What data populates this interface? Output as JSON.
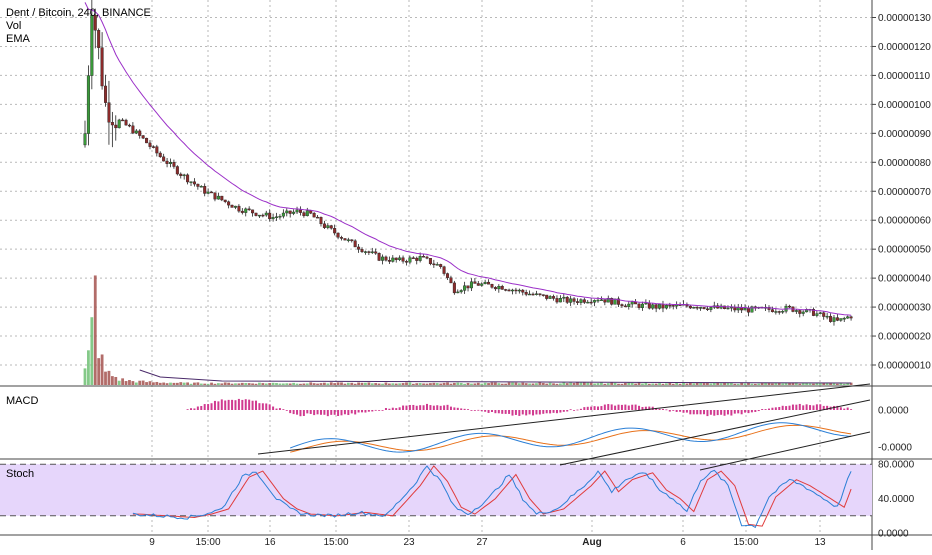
{
  "chart_data": {
    "type": "candlestick",
    "header": {
      "symbol": "Dent / Bitcoin, 240, BINANCE",
      "indicators": [
        "Vol",
        "EMA"
      ]
    },
    "panes": {
      "macd": {
        "label": "MACD",
        "ticks": [
          "0.0000",
          "-0.0000"
        ]
      },
      "stoch": {
        "label": "Stoch",
        "ticks": [
          "80.0000",
          "40.0000",
          "0.0000"
        ],
        "band": [
          20,
          80
        ]
      }
    },
    "price_axis": {
      "ticks": [
        "0.00000130",
        "0.00000120",
        "0.00000110",
        "0.00000100",
        "0.00000090",
        "0.00000080",
        "0.00000070",
        "0.00000060",
        "0.00000050",
        "0.00000040",
        "0.00000030",
        "0.00000020",
        "0.00000010"
      ],
      "values": [
        130,
        120,
        110,
        100,
        90,
        80,
        70,
        60,
        50,
        40,
        30,
        20,
        10
      ],
      "unit_scale": "1e-8"
    },
    "time_axis": {
      "labels": [
        "9",
        "15:00",
        "16",
        "15:00",
        "23",
        "27",
        "Aug",
        "6",
        "15:00",
        "13"
      ],
      "bold": [
        false,
        false,
        false,
        false,
        false,
        false,
        true,
        false,
        false,
        false
      ]
    },
    "price_series": {
      "name": "close",
      "anchors": [
        [
          0,
          90
        ],
        [
          2,
          135
        ],
        [
          4,
          118
        ],
        [
          6,
          100
        ],
        [
          9,
          95
        ],
        [
          13,
          92
        ],
        [
          17,
          88
        ],
        [
          22,
          82
        ],
        [
          28,
          76
        ],
        [
          35,
          70
        ],
        [
          45,
          64
        ],
        [
          55,
          61
        ],
        [
          62,
          63
        ],
        [
          66,
          62
        ],
        [
          70,
          58
        ],
        [
          78,
          52
        ],
        [
          86,
          47
        ],
        [
          92,
          46
        ],
        [
          98,
          47
        ],
        [
          104,
          44
        ],
        [
          108,
          36
        ],
        [
          114,
          38
        ],
        [
          122,
          37
        ],
        [
          132,
          34
        ],
        [
          142,
          32
        ],
        [
          150,
          33
        ],
        [
          158,
          31
        ],
        [
          168,
          30
        ],
        [
          178,
          30.5
        ],
        [
          186,
          29.5
        ],
        [
          196,
          29
        ],
        [
          206,
          29.5
        ],
        [
          213,
          28
        ],
        [
          220,
          25
        ],
        [
          224,
          27
        ]
      ],
      "ema_start": [
        0,
        140
      ]
    },
    "volume_series": {
      "anchors": [
        [
          0,
          15
        ],
        [
          1,
          30
        ],
        [
          2,
          60
        ],
        [
          3,
          100
        ],
        [
          4,
          40
        ],
        [
          5,
          25
        ],
        [
          6,
          14
        ],
        [
          8,
          10
        ],
        [
          10,
          6
        ],
        [
          14,
          4
        ],
        [
          20,
          3
        ],
        [
          30,
          2
        ],
        [
          60,
          2
        ],
        [
          100,
          2
        ],
        [
          224,
          2
        ]
      ]
    },
    "oscillators": {
      "stoch_k_anchors": [
        [
          14,
          22
        ],
        [
          22,
          20
        ],
        [
          30,
          18
        ],
        [
          35,
          22
        ],
        [
          40,
          28
        ],
        [
          46,
          65
        ],
        [
          50,
          72
        ],
        [
          56,
          40
        ],
        [
          60,
          28
        ],
        [
          64,
          22
        ],
        [
          72,
          20
        ],
        [
          80,
          24
        ],
        [
          88,
          20
        ],
        [
          96,
          55
        ],
        [
          100,
          78
        ],
        [
          104,
          60
        ],
        [
          108,
          30
        ],
        [
          112,
          22
        ],
        [
          118,
          40
        ],
        [
          124,
          68
        ],
        [
          128,
          40
        ],
        [
          132,
          22
        ],
        [
          138,
          28
        ],
        [
          146,
          55
        ],
        [
          150,
          72
        ],
        [
          154,
          48
        ],
        [
          158,
          62
        ],
        [
          164,
          70
        ],
        [
          168,
          50
        ],
        [
          172,
          40
        ],
        [
          176,
          25
        ],
        [
          180,
          62
        ],
        [
          184,
          72
        ],
        [
          188,
          55
        ],
        [
          192,
          10
        ],
        [
          196,
          8
        ],
        [
          200,
          42
        ],
        [
          206,
          62
        ],
        [
          210,
          55
        ],
        [
          214,
          45
        ],
        [
          220,
          30
        ],
        [
          224,
          72
        ]
      ]
    },
    "trendlines": [
      {
        "pane": "macd",
        "from": [
          258,
          454
        ],
        "to": [
          870,
          384
        ]
      },
      {
        "pane": "macd",
        "from": [
          560,
          465
        ],
        "to": [
          870,
          400
        ]
      },
      {
        "pane": "macd",
        "from": [
          700,
          470
        ],
        "to": [
          870,
          432
        ]
      }
    ],
    "grid": true,
    "colors": {
      "up": "#3a9a3a",
      "down": "#8b2b2b",
      "ema": "#9b30c8",
      "macd": "#2b7fd6",
      "signal": "#e8711a",
      "macd_hist": "#d03a8f",
      "stoch_k": "#2b7fd6",
      "stoch_d": "#e03c3c",
      "stoch_bg": "#e6d6fb"
    }
  }
}
